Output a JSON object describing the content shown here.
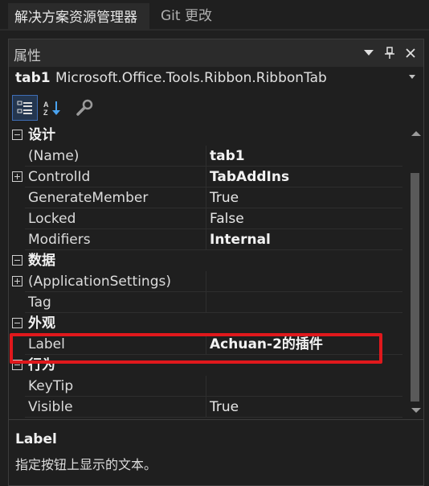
{
  "tabs": [
    {
      "label": "解决方案资源管理器"
    },
    {
      "label": "Git 更改"
    }
  ],
  "panel": {
    "title": "属性",
    "object_name": "tab1",
    "object_type": "Microsoft.Office.Tools.Ribbon.RibbonTab"
  },
  "toolbar": {
    "categorized_icon": "categorized-icon",
    "alphabetical_icon": "alphabetical-icon",
    "property_pages_icon": "wrench-icon"
  },
  "rows": [
    {
      "kind": "category",
      "label": "设计"
    },
    {
      "kind": "prop",
      "name": "(Name)",
      "value": "tab1",
      "bold": true,
      "expand": false
    },
    {
      "kind": "prop",
      "name": "ControlId",
      "value": "TabAddIns",
      "bold": true,
      "expand": true
    },
    {
      "kind": "prop",
      "name": "GenerateMember",
      "value": "True",
      "bold": false,
      "expand": false
    },
    {
      "kind": "prop",
      "name": "Locked",
      "value": "False",
      "bold": false,
      "expand": false
    },
    {
      "kind": "prop",
      "name": "Modifiers",
      "value": "Internal",
      "bold": true,
      "expand": false
    },
    {
      "kind": "category",
      "label": "数据"
    },
    {
      "kind": "prop",
      "name": "(ApplicationSettings)",
      "value": "",
      "bold": false,
      "expand": true
    },
    {
      "kind": "prop",
      "name": "Tag",
      "value": "",
      "bold": false,
      "expand": false
    },
    {
      "kind": "category",
      "label": "外观"
    },
    {
      "kind": "prop",
      "name": "Label",
      "value": "Achuan-2的插件",
      "bold": true,
      "expand": false
    },
    {
      "kind": "category",
      "label": "行为"
    },
    {
      "kind": "prop",
      "name": "KeyTip",
      "value": "",
      "bold": false,
      "expand": false
    },
    {
      "kind": "prop",
      "name": "Visible",
      "value": "True",
      "bold": false,
      "expand": false
    }
  ],
  "description": {
    "title": "Label",
    "text": "指定按钮上显示的文本。"
  },
  "colors": {
    "highlight": "#e0181c",
    "background": "#1f1f1f"
  }
}
